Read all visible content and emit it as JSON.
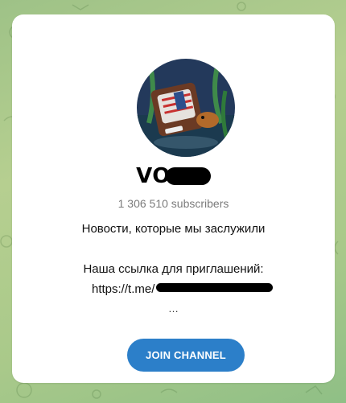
{
  "background": {
    "color": "#a9c98a"
  },
  "channel": {
    "avatar_icon": "channel-avatar-tv-illustration",
    "title_visible": "VO",
    "subscribers": "1 306 510 subscribers",
    "description_line1": "Новости, которые мы заслужили",
    "description_line2": "Наша ссылка для приглашений:",
    "link_prefix": "https://t.me/",
    "ellipsis": "…"
  },
  "actions": {
    "join_label": "JOIN CHANNEL",
    "join_color": "#2c7fc9"
  }
}
